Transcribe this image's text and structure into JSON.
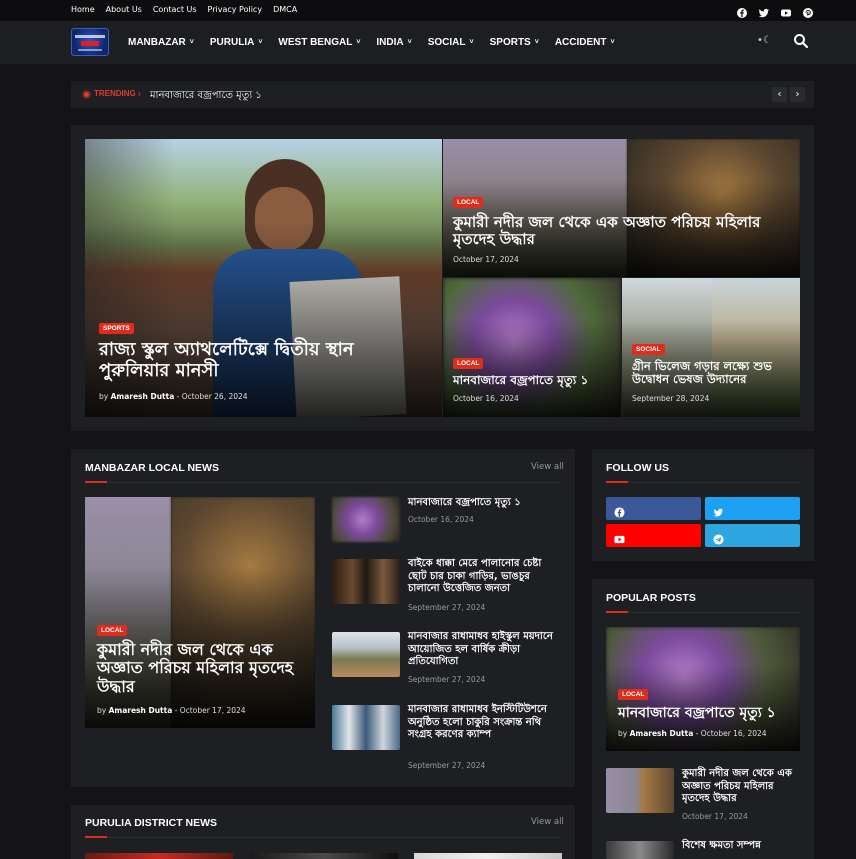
{
  "topbar": {
    "links": [
      "Home",
      "About Us",
      "Contact Us",
      "Privacy Policy",
      "DMCA"
    ],
    "social_icons": [
      "facebook-icon",
      "twitter-icon",
      "youtube-icon",
      "pinterest-icon"
    ]
  },
  "nav": {
    "items": [
      "MANBAZAR",
      "PURULIA",
      "WEST BENGAL",
      "INDIA",
      "SOCIAL",
      "SPORTS",
      "ACCIDENT"
    ],
    "chevron": "˅",
    "theme_glyph": "•☾"
  },
  "trending": {
    "label": "TRENDING ›",
    "text": "মানবাজারে বজ্রপাতে মৃত্যু ১",
    "prev": "‹",
    "next": "›"
  },
  "hero": {
    "main": {
      "badge": "SPORTS",
      "title": "রাজ্য স্কুল অ্যাথলেটিক্সে দ্বিতীয় স্থান পুরুলিয়ার মানসী",
      "by": "by",
      "author": "Amaresh Dutta",
      "date": "- October 26, 2024"
    },
    "top_right": {
      "badge": "LOCAL",
      "title": "কুমারী নদীর জল থেকে এক অজ্ঞাত পরিচয় মহিলার মৃতদেহ উদ্ধার",
      "date": "October 17, 2024"
    },
    "bottom_mid": {
      "badge": "LOCAL",
      "title": "মানবাজারে বজ্রপাতে মৃত্যু ১",
      "date": "October 16, 2024"
    },
    "bottom_right": {
      "badge": "SOCIAL",
      "title": "গ্রীন ভিলেজ গড়ার লক্ষ্যে শুভ উদ্বোধন ভেষজ উদ্যানের",
      "date": "September 28, 2024"
    }
  },
  "manbazar": {
    "title": "MANBAZAR LOCAL NEWS",
    "view_all": "View all",
    "feature": {
      "badge": "LOCAL",
      "title": "কুমারী নদীর জল থেকে এক অজ্ঞাত পরিচয় মহিলার মৃতদেহ উদ্ধার",
      "by": "by",
      "author": "Amaresh Dutta",
      "date": "- October 17, 2024"
    },
    "items": [
      {
        "title": "মানবাজারে বজ্রপাতে মৃত্যু ১",
        "date": "October 16, 2024"
      },
      {
        "title": "বাইকে ধাক্কা মেরে পালানোর চেষ্টা ছোট চার চাকা গাড়ির, ভাঙচুর চালানো উত্তেজিত জনতা",
        "date": "September 27, 2024"
      },
      {
        "title": "মানবাজার রাধামাধব হাইস্কুল ময়দানে আয়োজিত হল বার্ষিক ক্রীড়া প্রতিযোগিতা",
        "date": "September 27, 2024"
      },
      {
        "title": "মানবাজার রাধামাধব ইনস্টিটিউশনে অনুষ্ঠিত হলো চাকুরি সংক্রান্ত নথি সংগ্রহ করণের ক্যাম্প",
        "date": "September 27, 2024"
      }
    ]
  },
  "follow": {
    "title": "FOLLOW US",
    "buttons": [
      {
        "name": "facebook-follow-button",
        "icon": "facebook-icon",
        "color": "#3b5998"
      },
      {
        "name": "twitter-follow-button",
        "icon": "twitter-icon",
        "color": "#1da1f2"
      },
      {
        "name": "youtube-follow-button",
        "icon": "youtube-icon",
        "color": "#ff0000"
      },
      {
        "name": "telegram-follow-button",
        "icon": "telegram-icon",
        "color": "#2ca5e0"
      }
    ]
  },
  "popular": {
    "title": "POPULAR POSTS",
    "feature": {
      "badge": "LOCAL",
      "title": "মানবাজারে বজ্রপাতে মৃত্যু ১",
      "by": "by",
      "author": "Amaresh Dutta",
      "date": "- October 16, 2024"
    },
    "items": [
      {
        "title": "কুমারী নদীর জল থেকে এক অজ্ঞাত পরিচয় মহিলার মৃতদেহ উদ্ধার",
        "date": "October 17, 2024"
      },
      {
        "title": "বিশেষ ক্ষমতা সম্পন্ন",
        "date": ""
      }
    ]
  },
  "purulia": {
    "title": "PURULIA DISTRICT NEWS",
    "view_all": "View all"
  },
  "colors": {
    "accent": "#e02d1b",
    "background": "#141416",
    "panel": "#1e1f23"
  }
}
